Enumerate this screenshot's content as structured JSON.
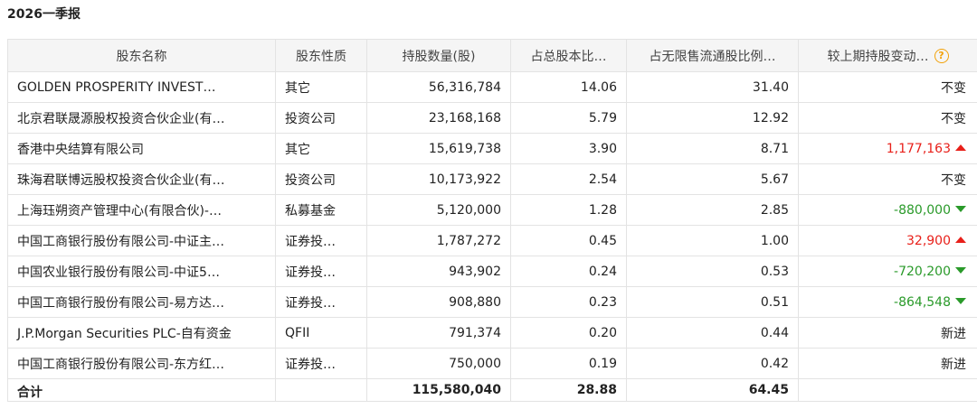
{
  "report": {
    "title": "2026一季报"
  },
  "table": {
    "headers": [
      "股东名称",
      "股东性质",
      "持股数量(股)",
      "占总股本比…",
      "占无限售流通股比例…",
      "较上期持股变动…"
    ],
    "help_icon": "question-circle-icon",
    "colors": {
      "increase": "#e8201a",
      "decrease": "#2a9a2a",
      "header_bg": "#f5f5f5",
      "help": "#f2a20a"
    },
    "rows": [
      {
        "name": "GOLDEN PROSPERITY INVEST…",
        "type": "其它",
        "shares": "56,316,784",
        "pct_total": "14.06",
        "pct_float": "31.40",
        "change": "不变",
        "dir": "none"
      },
      {
        "name": "北京君联晟源股权投资合伙企业(有…",
        "type": "投资公司",
        "shares": "23,168,168",
        "pct_total": "5.79",
        "pct_float": "12.92",
        "change": "不变",
        "dir": "none"
      },
      {
        "name": "香港中央结算有限公司",
        "type": "其它",
        "shares": "15,619,738",
        "pct_total": "3.90",
        "pct_float": "8.71",
        "change": "1,177,163",
        "dir": "up"
      },
      {
        "name": "珠海君联博远股权投资合伙企业(有…",
        "type": "投资公司",
        "shares": "10,173,922",
        "pct_total": "2.54",
        "pct_float": "5.67",
        "change": "不变",
        "dir": "none"
      },
      {
        "name": "上海珏朔资产管理中心(有限合伙)-…",
        "type": "私募基金",
        "shares": "5,120,000",
        "pct_total": "1.28",
        "pct_float": "2.85",
        "change": "-880,000",
        "dir": "down"
      },
      {
        "name": "中国工商银行股份有限公司-中证主…",
        "type": "证券投…",
        "shares": "1,787,272",
        "pct_total": "0.45",
        "pct_float": "1.00",
        "change": "32,900",
        "dir": "up"
      },
      {
        "name": "中国农业银行股份有限公司-中证5…",
        "type": "证券投…",
        "shares": "943,902",
        "pct_total": "0.24",
        "pct_float": "0.53",
        "change": "-720,200",
        "dir": "down"
      },
      {
        "name": "中国工商银行股份有限公司-易方达…",
        "type": "证券投…",
        "shares": "908,880",
        "pct_total": "0.23",
        "pct_float": "0.51",
        "change": "-864,548",
        "dir": "down"
      },
      {
        "name": "J.P.Morgan Securities PLC-自有资金",
        "type": "QFII",
        "shares": "791,374",
        "pct_total": "0.20",
        "pct_float": "0.44",
        "change": "新进",
        "dir": "none"
      },
      {
        "name": "中国工商银行股份有限公司-东方红…",
        "type": "证券投…",
        "shares": "750,000",
        "pct_total": "0.19",
        "pct_float": "0.42",
        "change": "新进",
        "dir": "none"
      }
    ],
    "total": {
      "label": "合计",
      "shares": "115,580,040",
      "pct_total": "28.88",
      "pct_float": "64.45"
    }
  }
}
